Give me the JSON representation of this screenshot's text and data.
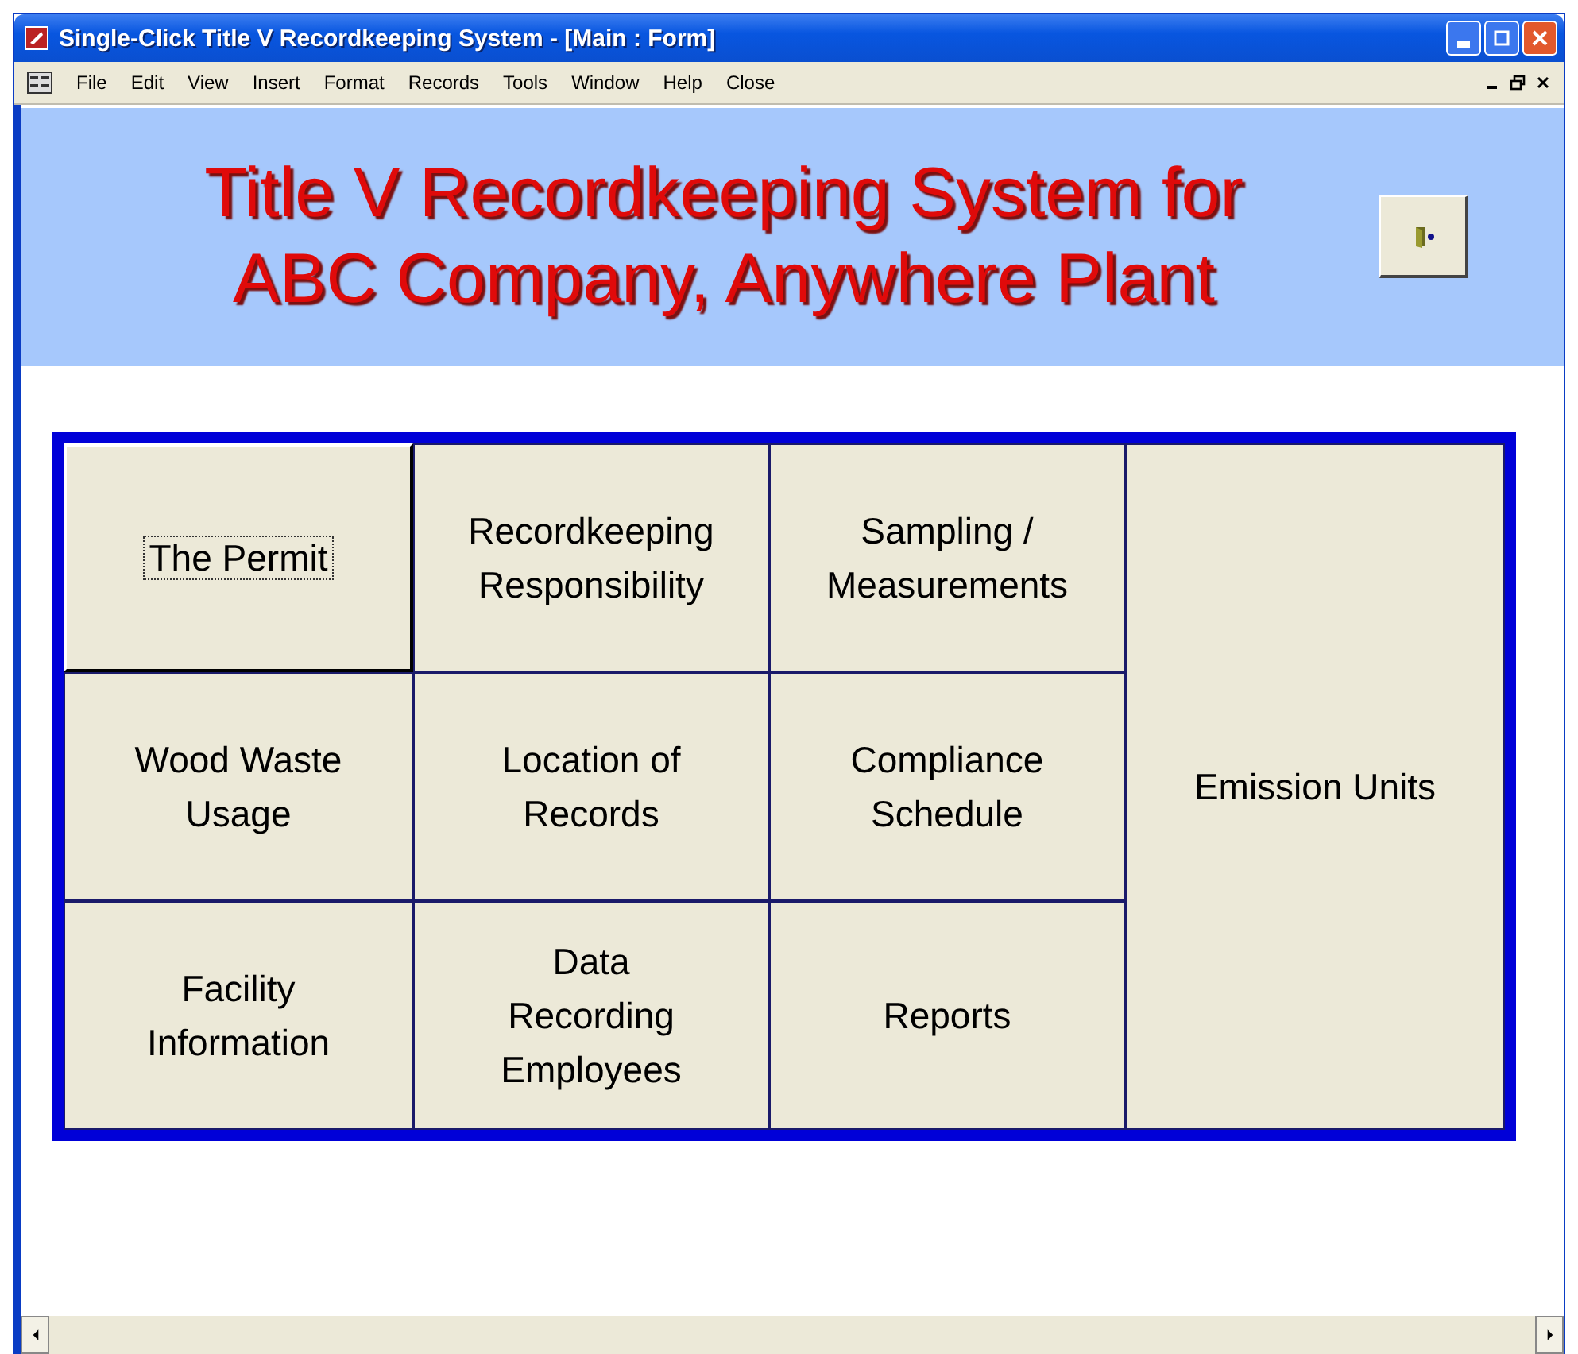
{
  "window": {
    "title": "Single-Click Title V Recordkeeping System - [Main : Form]"
  },
  "menu": [
    "File",
    "Edit",
    "View",
    "Insert",
    "Format",
    "Records",
    "Tools",
    "Window",
    "Help",
    "Close"
  ],
  "header": {
    "title": "Title V Recordkeeping System for\nABC Company, Anywhere Plant"
  },
  "buttons": [
    {
      "label": "The Permit",
      "kind": "normal",
      "focused": true
    },
    {
      "label": "Recordkeeping\nResponsibility",
      "kind": "normal",
      "focused": false
    },
    {
      "label": "Sampling /\nMeasurements",
      "kind": "normal",
      "focused": false
    },
    {
      "label": "Wood Waste\nUsage",
      "kind": "normal",
      "focused": false
    },
    {
      "label": "Location of\nRecords",
      "kind": "normal",
      "focused": false
    },
    {
      "label": "Compliance\nSchedule",
      "kind": "normal",
      "focused": false
    },
    {
      "label": "Emission Units",
      "kind": "tall",
      "focused": false
    },
    {
      "label": "Facility\nInformation",
      "kind": "normal",
      "focused": false
    },
    {
      "label": "Data\nRecording\nEmployees",
      "kind": "normal",
      "focused": false
    },
    {
      "label": "Reports",
      "kind": "normal",
      "focused": false
    }
  ]
}
